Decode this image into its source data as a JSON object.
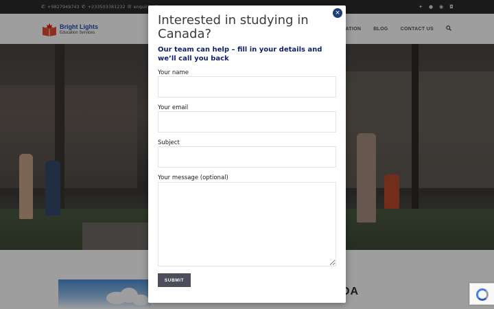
{
  "topbar": {
    "phone1": "+9827949743",
    "phone2": "+233503381232",
    "email": "enquiries@..."
  },
  "header": {
    "logo_title": "Bright Lights",
    "logo_subtitle": "Education Services",
    "nav": [
      "APPLICATION",
      "BLOG",
      "CONTACT US"
    ]
  },
  "page": {
    "heading_peek": "DA"
  },
  "modal": {
    "title": "Interested in studying in Canada?",
    "subtitle": "Our team can help – fill in your details and we’ll call you back",
    "fields": {
      "name_label": "Your name",
      "email_label": "Your email",
      "subject_label": "Subject",
      "message_label": "Your message (optional)"
    },
    "submit_label": "SUBMIT",
    "close_symbol": "×"
  },
  "colors": {
    "accent_navy": "#0d1f6b",
    "close_button": "#1c3f78",
    "submit_button": "#4d4d5c",
    "logo_blue": "#1e4fb5"
  },
  "icons": {
    "topbar_contact": [
      "phone-icon",
      "phone-icon",
      "envelope-icon"
    ],
    "topbar_social": [
      "twitter-icon",
      "facebook-icon",
      "pinterest-icon",
      "instagram-icon"
    ],
    "header": [
      "search-icon"
    ],
    "modal": [
      "close-icon"
    ]
  }
}
